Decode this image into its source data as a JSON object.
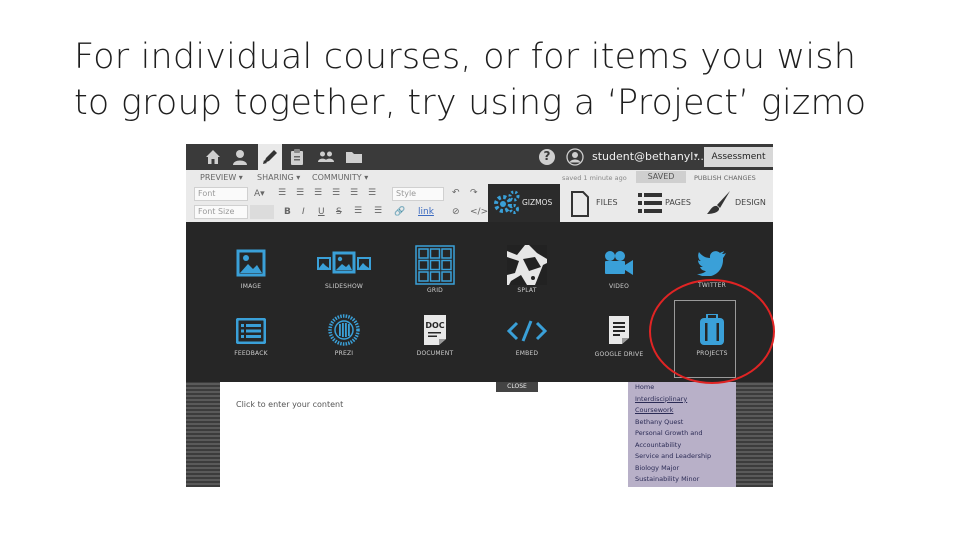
{
  "slide": {
    "title_line1": "For individual courses, or for items you wish",
    "title_line2": "to group together, try using a ‘Project’ gizmo"
  },
  "topbar": {
    "icons": [
      "home-icon",
      "user-icon",
      "edit-icon",
      "clipboard-icon",
      "group-icon",
      "folder-icon"
    ],
    "help_label": "?",
    "user": "student@bethanyl...",
    "portfolio": "Assessment"
  },
  "toolbar": {
    "menus": [
      "PREVIEW ▾",
      "SHARING ▾",
      "COMMUNITY ▾"
    ],
    "saved_status": "saved 1 minute ago",
    "saved_label": "SAVED",
    "publish_label": "PUBLISH CHANGES",
    "font_placeholder": "Font",
    "font_size_placeholder": "Font Size",
    "style_placeholder": "Style",
    "link_label": "link",
    "format_buttons": [
      "B",
      "I",
      "U",
      "S"
    ],
    "panels": {
      "gizmos": "GIZMOS",
      "files": "FILES",
      "pages": "PAGES",
      "design": "DESIGN"
    }
  },
  "gizmos": [
    {
      "label": "IMAGE",
      "icon": "image-icon"
    },
    {
      "label": "SLIDESHOW",
      "icon": "slideshow-icon"
    },
    {
      "label": "GRID",
      "icon": "grid-icon"
    },
    {
      "label": "SPLAT",
      "icon": "splat-icon"
    },
    {
      "label": "VIDEO",
      "icon": "video-icon"
    },
    {
      "label": "TWITTER",
      "icon": "twitter-icon"
    },
    {
      "label": "FEEDBACK",
      "icon": "feedback-icon"
    },
    {
      "label": "PREZI",
      "icon": "prezi-icon"
    },
    {
      "label": "DOCUMENT",
      "icon": "document-icon"
    },
    {
      "label": "EMBED",
      "icon": "embed-icon"
    },
    {
      "label": "GOOGLE DRIVE",
      "icon": "google-drive-icon"
    },
    {
      "label": "PROJECTS",
      "icon": "projects-icon"
    }
  ],
  "content": {
    "close_label": "CLOSE",
    "placeholder": "Click to enter your content"
  },
  "sidebar": {
    "items": [
      {
        "label": "Home",
        "link": false
      },
      {
        "label": "Interdisciplinary",
        "link": true
      },
      {
        "label": "Coursework",
        "link": true
      },
      {
        "label": "Bethany Quest",
        "link": false
      },
      {
        "label": "Personal Growth and",
        "link": false
      },
      {
        "label": "Accountability",
        "link": false
      },
      {
        "label": "Service and Leadership",
        "link": false
      },
      {
        "label": "Biology Major",
        "link": false
      },
      {
        "label": "Sustainability Minor",
        "link": false
      }
    ]
  },
  "colors": {
    "accent": "#3aa0d8",
    "panel_bg": "#262626",
    "highlight": "#e02424",
    "sidebar_bg": "#b8b0c8"
  }
}
